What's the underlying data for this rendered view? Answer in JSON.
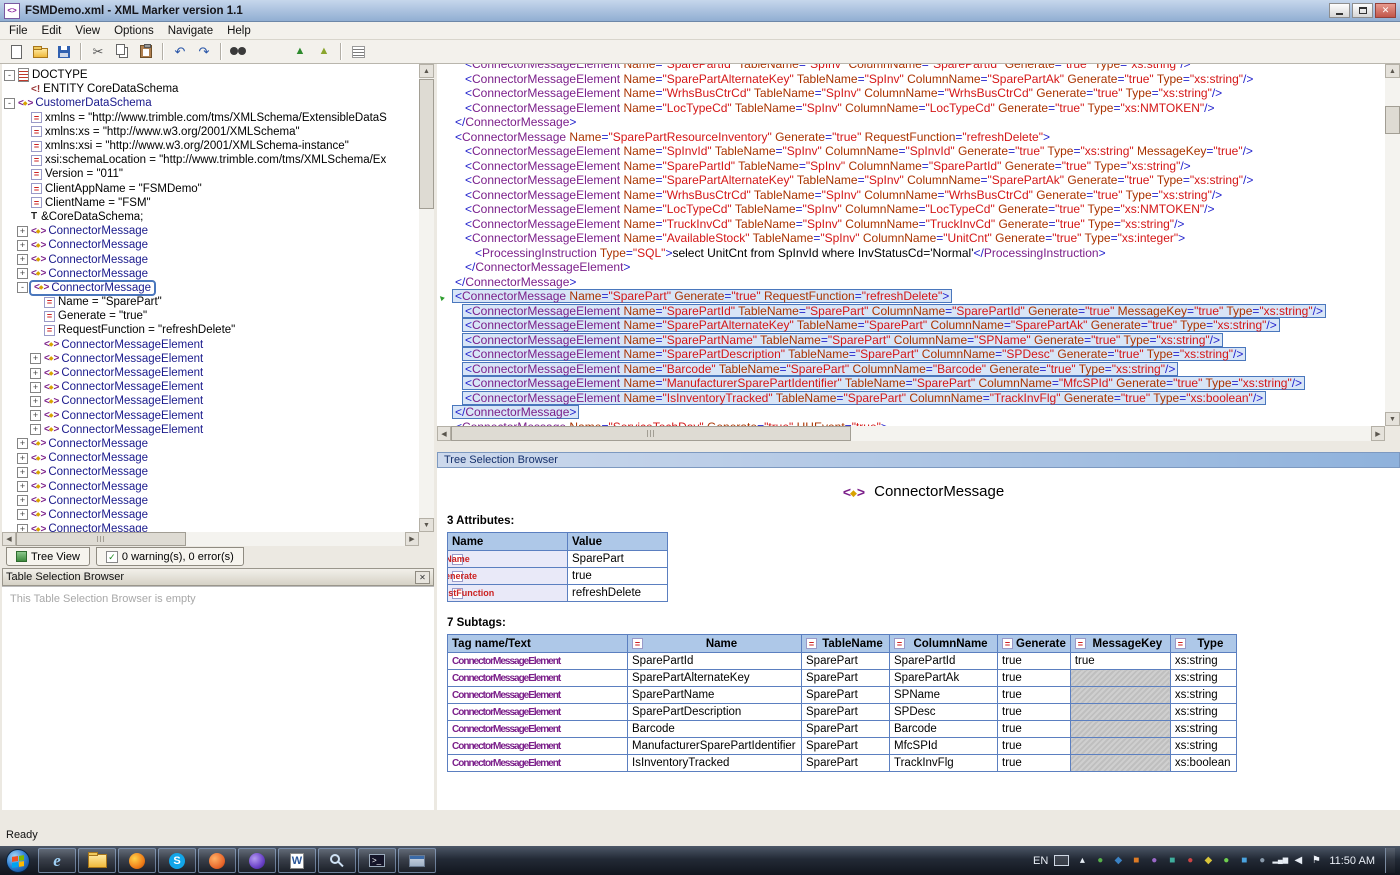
{
  "window": {
    "title": "FSMDemo.xml  -  XML Marker version 1.1",
    "controls": [
      {
        "name": "minimize"
      },
      {
        "name": "maximize"
      },
      {
        "name": "close"
      }
    ]
  },
  "menu": {
    "items": [
      "File",
      "Edit",
      "View",
      "Options",
      "Navigate",
      "Help"
    ]
  },
  "toolbar": {
    "items": [
      {
        "name": "new-document"
      },
      {
        "name": "open-file"
      },
      {
        "name": "save-file"
      },
      {
        "sep": true
      },
      {
        "name": "cut"
      },
      {
        "name": "copy"
      },
      {
        "name": "paste"
      },
      {
        "sep": true
      },
      {
        "name": "undo"
      },
      {
        "name": "redo"
      },
      {
        "sep": true
      },
      {
        "name": "find"
      },
      {
        "gap": true
      },
      {
        "name": "previous-bookmark"
      },
      {
        "name": "next-bookmark"
      },
      {
        "sep": true
      },
      {
        "name": "view-list"
      }
    ]
  },
  "left_panel": {
    "tree": {
      "items": [
        {
          "ind": 0,
          "exp": "minus",
          "icon": "doctype",
          "kind": "plain",
          "t": "DOCTYPE"
        },
        {
          "ind": 1,
          "icon": "entity",
          "kind": "plain",
          "t": "ENTITY CoreDataSchema"
        },
        {
          "ind": 0,
          "exp": "minus",
          "icon": "xml",
          "kind": "el",
          "t": "CustomerDataSchema"
        },
        {
          "ind": 1,
          "icon": "attr",
          "kind": "plain",
          "t": "xmlns = \"http://www.trimble.com/tms/XMLSchema/ExtensibleDataS"
        },
        {
          "ind": 1,
          "icon": "attr",
          "kind": "plain",
          "t": "xmlns:xs = \"http://www.w3.org/2001/XMLSchema\""
        },
        {
          "ind": 1,
          "icon": "attr",
          "kind": "plain",
          "t": "xmlns:xsi = \"http://www.w3.org/2001/XMLSchema-instance\""
        },
        {
          "ind": 1,
          "icon": "attr",
          "kind": "plain",
          "t": "xsi:schemaLocation = \"http://www.trimble.com/tms/XMLSchema/Ex"
        },
        {
          "ind": 1,
          "icon": "attr",
          "kind": "plain",
          "t": "Version = \"011\""
        },
        {
          "ind": 1,
          "icon": "attr",
          "kind": "plain",
          "t": "ClientAppName = \"FSMDemo\""
        },
        {
          "ind": 1,
          "icon": "attr",
          "kind": "plain",
          "t": "ClientName = \"FSM\""
        },
        {
          "ind": 1,
          "icon": "textnode",
          "kind": "plain",
          "t": "&CoreDataSchema;"
        },
        {
          "ind": 1,
          "exp": "plus",
          "icon": "xml",
          "kind": "el",
          "t": "ConnectorMessage"
        },
        {
          "ind": 1,
          "exp": "plus",
          "icon": "xml",
          "kind": "el",
          "t": "ConnectorMessage"
        },
        {
          "ind": 1,
          "exp": "plus",
          "icon": "xml",
          "kind": "el",
          "t": "ConnectorMessage"
        },
        {
          "ind": 1,
          "exp": "plus",
          "icon": "xml",
          "kind": "el",
          "t": "ConnectorMessage"
        },
        {
          "ind": 1,
          "exp": "minus",
          "icon": "xml",
          "kind": "el",
          "sel": true,
          "t": "ConnectorMessage"
        },
        {
          "ind": 2,
          "icon": "attr",
          "kind": "plain",
          "t": "Name = \"SparePart\""
        },
        {
          "ind": 2,
          "icon": "attr",
          "kind": "plain",
          "t": "Generate = \"true\""
        },
        {
          "ind": 2,
          "icon": "attr",
          "kind": "plain",
          "t": "RequestFunction = \"refreshDelete\""
        },
        {
          "ind": 2,
          "icon": "xml",
          "kind": "el",
          "t": "ConnectorMessageElement"
        },
        {
          "ind": 2,
          "exp": "plus",
          "icon": "xml",
          "kind": "el",
          "t": "ConnectorMessageElement"
        },
        {
          "ind": 2,
          "exp": "plus",
          "icon": "xml",
          "kind": "el",
          "t": "ConnectorMessageElement"
        },
        {
          "ind": 2,
          "exp": "plus",
          "icon": "xml",
          "kind": "el",
          "t": "ConnectorMessage​Element"
        },
        {
          "ind": 2,
          "exp": "plus",
          "icon": "xml",
          "kind": "el",
          "t": "ConnectorMessageElement"
        },
        {
          "ind": 2,
          "exp": "plus",
          "icon": "xml",
          "kind": "el",
          "t": "ConnectorMessageElement"
        },
        {
          "ind": 2,
          "exp": "plus",
          "icon": "xml",
          "kind": "el",
          "t": "ConnectorMessageElement"
        },
        {
          "ind": 1,
          "exp": "plus",
          "icon": "xml",
          "kind": "el",
          "t": "ConnectorMessage"
        },
        {
          "ind": 1,
          "exp": "plus",
          "icon": "xml",
          "kind": "el",
          "t": "ConnectorMessage"
        },
        {
          "ind": 1,
          "exp": "plus",
          "icon": "xml",
          "kind": "el",
          "t": "ConnectorMessage"
        },
        {
          "ind": 1,
          "exp": "plus",
          "icon": "xml",
          "kind": "el",
          "t": "ConnectorMessage"
        },
        {
          "ind": 1,
          "exp": "plus",
          "icon": "xml",
          "kind": "el",
          "t": "ConnectorMessage"
        },
        {
          "ind": 1,
          "exp": "plus",
          "icon": "xml",
          "kind": "el",
          "t": "ConnectorMessage"
        },
        {
          "ind": 1,
          "exp": "plus",
          "icon": "xml",
          "kind": "el",
          "t": "ConnectorMessage"
        }
      ]
    },
    "tabs": {
      "tree_view_label": "Tree View",
      "status_label": "0 warning(s), 0 error(s)"
    },
    "table_selection_browser": {
      "title": "Table Selection Browser",
      "empty_message": "This Table Selection Browser is empty"
    }
  },
  "editor": {
    "lines": [
      {
        "ind": 2,
        "clip": true,
        "t": "<ConnectorMessageElement Name=\"SparePartId\" TableName=\"SpInv\" ColumnName=\"SparePartId\" Generate=\"true\" Type=\"xs:string\"/>"
      },
      {
        "ind": 2,
        "t": "<ConnectorMessageElement Name=\"SparePartAlternateKey\" TableName=\"SpInv\" ColumnName=\"SparePartAk\" Generate=\"true\" Type=\"xs:string\"/>"
      },
      {
        "ind": 2,
        "t": "<ConnectorMessageElement Name=\"WrhsBusCtrCd\" TableName=\"SpInv\" ColumnName=\"WrhsBusCtrCd\" Generate=\"true\" Type=\"xs:string\"/>"
      },
      {
        "ind": 2,
        "t": "<ConnectorMessageElement Name=\"LocTypeCd\" TableName=\"SpInv\" ColumnName=\"LocTypeCd\" Generate=\"true\" Type=\"xs:NMTOKEN\"/>"
      },
      {
        "ind": 1,
        "t": "</ConnectorMessage>"
      },
      {
        "ind": 1,
        "t": "<ConnectorMessage Name=\"SparePartResourceInventory\" Generate=\"true\" RequestFunction=\"refreshDelete\">"
      },
      {
        "ind": 2,
        "t": "<ConnectorMessageElement Name=\"SpInvId\" TableName=\"SpInv\" ColumnName=\"SpInvId\" Generate=\"true\" Type=\"xs:string\" MessageKey=\"true\"/>"
      },
      {
        "ind": 2,
        "t": "<ConnectorMessageElement Name=\"SparePartId\" TableName=\"SpInv\" ColumnName=\"SparePartId\" Generate=\"true\" Type=\"xs:string\"/>"
      },
      {
        "ind": 2,
        "t": "<ConnectorMessageElement Name=\"SparePartAlternateKey\" TableName=\"SpInv\" ColumnName=\"SparePartAk\" Generate=\"true\" Type=\"xs:string\"/>"
      },
      {
        "ind": 2,
        "t": "<ConnectorMessageElement Name=\"WrhsBusCtrCd\" TableName=\"SpInv\" ColumnName=\"WrhsBusCtrCd\" Generate=\"true\" Type=\"xs:string\"/>"
      },
      {
        "ind": 2,
        "t": "<ConnectorMessageElement Name=\"LocTypeCd\" TableName=\"SpInv\" ColumnName=\"LocTypeCd\" Generate=\"true\" Type=\"xs:NMTOKEN\"/>"
      },
      {
        "ind": 2,
        "t": "<ConnectorMessageElement Name=\"TruckInvCd\" TableName=\"SpInv\" ColumnName=\"TruckInvCd\" Generate=\"true\" Type=\"xs:string\"/>"
      },
      {
        "ind": 2,
        "t": "<ConnectorMessageElement Name=\"AvailableStock\" TableName=\"SpInv\" ColumnName=\"UnitCnt\" Generate=\"true\" Type=\"xs:integer\">"
      },
      {
        "ind": 3,
        "t": "<ProcessingInstruction Type=\"SQL\">select UnitCnt from SpInvId where InvStatusCd='Normal'</ProcessingInstruction>"
      },
      {
        "ind": 2,
        "t": "</ConnectorMessageElement>"
      },
      {
        "ind": 1,
        "t": "</ConnectorMessage>"
      },
      {
        "ind": 1,
        "hl": true,
        "marker": true,
        "t": "<ConnectorMessage Name=\"SparePart\" Generate=\"true\" RequestFunction=\"refreshDelete\">"
      },
      {
        "ind": 2,
        "hl": true,
        "t": "<ConnectorMessageElement Name=\"SparePartId\" TableName=\"SparePart\" ColumnName=\"SparePartId\" Generate=\"true\" MessageKey=\"true\" Type=\"xs:string\"/>"
      },
      {
        "ind": 2,
        "hl": true,
        "t": "<ConnectorMessageElement Name=\"SparePartAlternateKey\" TableName=\"SparePart\" ColumnName=\"SparePartAk\" Generate=\"true\" Type=\"xs:string\"/>"
      },
      {
        "ind": 2,
        "hl": true,
        "t": "<ConnectorMessageElement Name=\"SparePartName\" TableName=\"SparePart\" ColumnName=\"SPName\" Generate=\"true\" Type=\"xs:string\"/>"
      },
      {
        "ind": 2,
        "hl": true,
        "t": "<ConnectorMessageElement Name=\"SparePartDescription\" TableName=\"SparePart\" ColumnName=\"SPDesc\" Generate=\"true\" Type=\"xs:string\"/>"
      },
      {
        "ind": 2,
        "hl": true,
        "t": "<ConnectorMessageElement Name=\"Barcode\" TableName=\"SparePart\" ColumnName=\"Barcode\" Generate=\"true\" Type=\"xs:string\"/>"
      },
      {
        "ind": 2,
        "hl": true,
        "t": "<ConnectorMessageElement Name=\"ManufacturerSparePartIdentifier\" TableName=\"SparePart\" ColumnName=\"MfcSPId\" Generate=\"true\" Type=\"xs:string\"/>"
      },
      {
        "ind": 2,
        "hl": true,
        "t": "<ConnectorMessageElement Name=\"IsInventoryTracked\" TableName=\"SparePart\" ColumnName=\"TrackInvFlg\" Generate=\"true\" Type=\"xs:boolean\"/>"
      },
      {
        "ind": 1,
        "hl": true,
        "t": "</ConnectorMessage>"
      },
      {
        "ind": 1,
        "t": "<ConnectorMessage Name=\"ServiceTechDay\" Generate=\"true\" HHEvent=\"true\">"
      }
    ]
  },
  "tree_selection_browser": {
    "title": "Tree Selection Browser",
    "node_title": "ConnectorMessage",
    "attributes_label": "3 Attributes:",
    "attributes_table": {
      "headers": [
        "Name",
        "Value"
      ],
      "rows": [
        {
          "name": "Name",
          "value": "SparePart"
        },
        {
          "name": "Generate",
          "value": "true"
        },
        {
          "name": "RequestFunction",
          "value": "refreshDelete"
        }
      ]
    },
    "subtags_label": "7 Subtags:",
    "subtags_table": {
      "headers": [
        "Tag name/Text",
        "Name",
        "TableName",
        "ColumnName",
        "Generate",
        "MessageKey",
        "Type"
      ],
      "rows": [
        {
          "tag": "ConnectorMessageElement",
          "name": "SparePartId",
          "table_name": "SparePart",
          "column_name": "SparePartId",
          "generate": "true",
          "message_key": "true",
          "type": "xs:string"
        },
        {
          "tag": "ConnectorMessageElement",
          "name": "SparePartAlternateKey",
          "table_name": "SparePart",
          "column_name": "SparePartAk",
          "generate": "true",
          "message_key": "",
          "type": "xs:string"
        },
        {
          "tag": "ConnectorMessageElement",
          "name": "SparePartName",
          "table_name": "SparePart",
          "column_name": "SPName",
          "generate": "true",
          "message_key": "",
          "type": "xs:string"
        },
        {
          "tag": "ConnectorMessageElement",
          "name": "SparePartDescription",
          "table_name": "SparePart",
          "column_name": "SPDesc",
          "generate": "true",
          "message_key": "",
          "type": "xs:string"
        },
        {
          "tag": "ConnectorMessageElement",
          "name": "Barcode",
          "table_name": "SparePart",
          "column_name": "Barcode",
          "generate": "true",
          "message_key": "",
          "type": "xs:string"
        },
        {
          "tag": "ConnectorMessageElement",
          "name": "ManufacturerSparePartIdentifier",
          "table_name": "SparePart",
          "column_name": "MfcSPId",
          "generate": "true",
          "message_key": "",
          "type": "xs:string"
        },
        {
          "tag": "ConnectorMessageElement",
          "name": "IsInventoryTracked",
          "table_name": "SparePart",
          "column_name": "TrackInvFlg",
          "generate": "true",
          "message_key": "",
          "type": "xs:boolean"
        }
      ]
    }
  },
  "status_bar": {
    "text": "Ready"
  },
  "taskbar": {
    "buttons": [
      {
        "name": "internet-explorer"
      },
      {
        "name": "file-explorer"
      },
      {
        "name": "firefox"
      },
      {
        "name": "skype"
      },
      {
        "name": "app-orange"
      },
      {
        "name": "app-purple"
      },
      {
        "name": "word-document"
      },
      {
        "name": "screen-magnifier"
      },
      {
        "name": "command-prompt"
      },
      {
        "name": "remote-desktop"
      }
    ],
    "tray": {
      "language": "EN",
      "time": "11:50 AM",
      "icons": [
        {
          "name": "show-hidden-icons",
          "glyph": "▴",
          "color": "#e6ecf4"
        },
        {
          "name": "tray-app-1",
          "glyph": "●",
          "color": "#56b04a"
        },
        {
          "name": "tray-app-2",
          "glyph": "◆",
          "color": "#3b82c4"
        },
        {
          "name": "tray-app-3",
          "glyph": "■",
          "color": "#de7b25"
        },
        {
          "name": "tray-app-4",
          "glyph": "●",
          "color": "#9a68c8"
        },
        {
          "name": "tray-app-5",
          "glyph": "■",
          "color": "#3fae9d"
        },
        {
          "name": "tray-app-6",
          "glyph": "●",
          "color": "#cc4444"
        },
        {
          "name": "tray-app-7",
          "glyph": "◆",
          "color": "#d9c53a"
        },
        {
          "name": "tray-app-8",
          "glyph": "●",
          "color": "#6fcf4f"
        },
        {
          "name": "tray-app-9",
          "glyph": "■",
          "color": "#4aa3df"
        },
        {
          "name": "tray-app-10",
          "glyph": "●",
          "color": "#8899aa"
        },
        {
          "name": "network",
          "glyph": "▂▄▆",
          "color": "#e6ecf4"
        },
        {
          "name": "volume",
          "glyph": "◀",
          "color": "#e6ecf4"
        },
        {
          "name": "action-center",
          "glyph": "⚑",
          "color": "#eef2f8"
        }
      ]
    }
  },
  "colors": {
    "tag_color": "#7b1f8a",
    "attr_name_color": "#aa3300",
    "attr_value_color": "#d41717",
    "punct_color": "#2222cc",
    "tree_element_color": "#1a1a8c",
    "selection_bg": "#d8e5f7",
    "selection_border": "#4a77bd",
    "table_header_bg": "#aec8e8",
    "attr_cell_bg": "#e9e9f8",
    "disabled_cell_bg": "#bfbfbf",
    "header_grad_left": "#cdd9ec",
    "header_grad_right": "#8fb2dc"
  }
}
